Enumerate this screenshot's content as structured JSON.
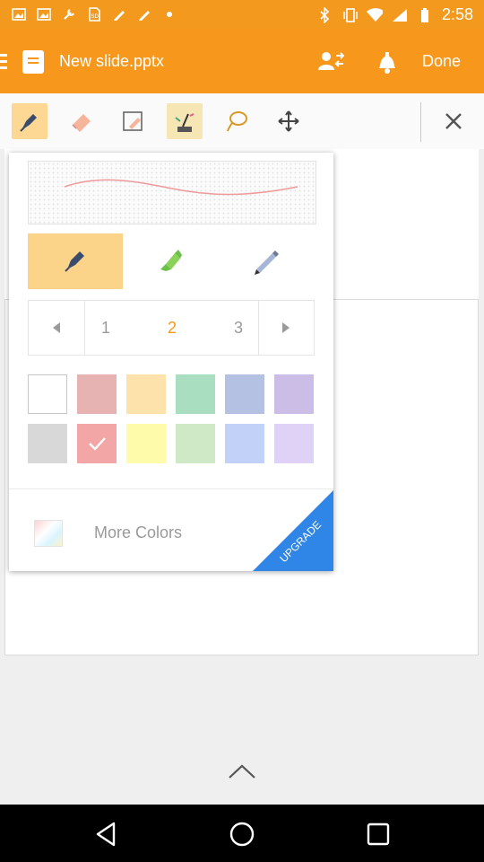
{
  "status_bar": {
    "time": "2:58",
    "left_icons": [
      "image-icon",
      "image-icon",
      "wrench-icon",
      "sd-card-icon",
      "pen-icon",
      "pen-icon",
      "dot-icon"
    ],
    "right_icons": [
      "bluetooth-icon",
      "vibrate-icon",
      "wifi-icon",
      "signal-icon",
      "battery-icon"
    ]
  },
  "header": {
    "title": "New slide.pptx",
    "done_label": "Done",
    "accent": "#f7981c"
  },
  "toolbar": {
    "tools": [
      "pen",
      "eraser",
      "pencil-eraser",
      "ink-brush",
      "lasso",
      "move"
    ],
    "active_tool": "pen",
    "close_icon": "close-icon"
  },
  "pen_panel": {
    "pen_types": [
      "pen",
      "highlighter",
      "pencil"
    ],
    "selected_pen": "pen",
    "pager": {
      "pages": [
        "1",
        "2",
        "3"
      ],
      "current": "2"
    },
    "colors_row1": [
      "#ffffff",
      "#e6b2b2",
      "#fde3ab",
      "#a9dfc0",
      "#b5c1e3",
      "#cbbde6"
    ],
    "colors_row2": [
      "#d8d8d8",
      "#f2a6a6",
      "#fefbab",
      "#cfe9c6",
      "#c2d1f7",
      "#e0d1f7"
    ],
    "selected_color": "#f2a6a6",
    "more_colors_label": "More Colors",
    "upgrade_label": "UPGRADE",
    "upgrade_color": "#2f86e6",
    "stroke_color": "#ef9a9a"
  },
  "nav_bar": {
    "buttons": [
      "back-icon",
      "home-icon",
      "recents-icon"
    ]
  }
}
